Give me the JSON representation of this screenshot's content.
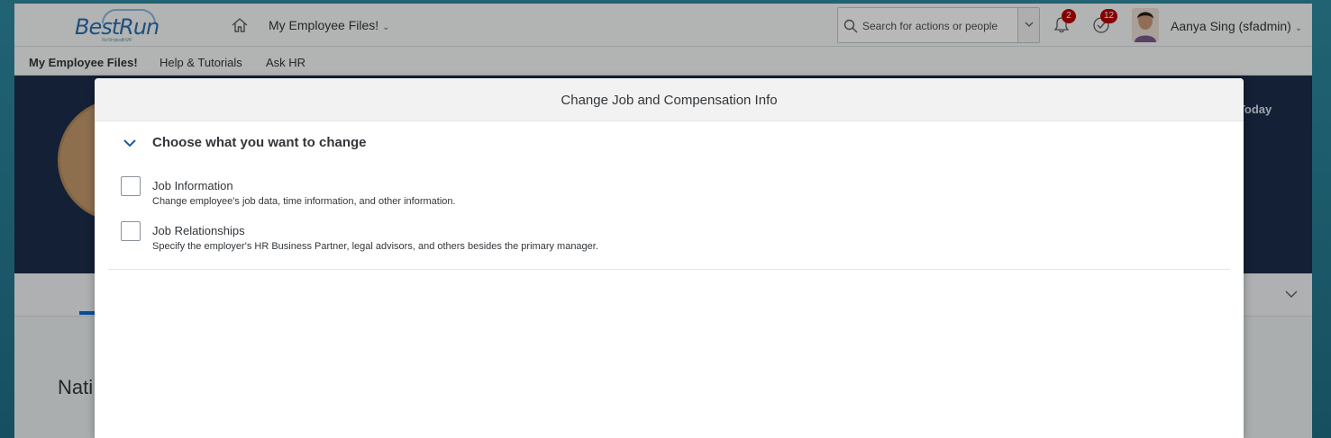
{
  "app": {
    "logo_text": "BestRun",
    "logo_tagline": "Run Simple with SAP",
    "nav_title": "My Employee Files!",
    "search_placeholder": "Search for actions or people",
    "notifications_count": "2",
    "todo_count": "12",
    "user_name": "Aanya Sing (sfadmin)"
  },
  "subnav": {
    "items": [
      "My Employee Files!",
      "Help & Tutorials",
      "Ask HR"
    ]
  },
  "background": {
    "hero_as_of": "f Today",
    "content_title_fragment": "Nati"
  },
  "dialog": {
    "title": "Change Job and Compensation Info",
    "section_title": "Choose what you want to change",
    "options": [
      {
        "label": "Job Information",
        "description": "Change employee's job data, time information, and other information.",
        "checked": false
      },
      {
        "label": "Job Relationships",
        "description": "Specify the employer's HR Business Partner, legal advisors, and others besides the primary manager.",
        "checked": false
      }
    ]
  },
  "colors": {
    "accent": "#0a6ed1",
    "badge": "#bb0000",
    "hero_bg": "#1c2d4a"
  },
  "icons": [
    "home-icon",
    "chevron-down-icon",
    "search-icon",
    "bell-icon",
    "todo-check-icon",
    "avatar"
  ]
}
